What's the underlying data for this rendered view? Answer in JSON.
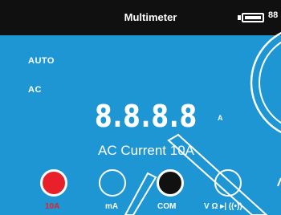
{
  "header": {
    "title": "Multimeter",
    "battery_level": "88"
  },
  "status": {
    "auto": "AUTO",
    "coupling": "AC"
  },
  "display": {
    "reading": "8.8.8.8",
    "unit": "A",
    "range_name": "AC Current 10A"
  },
  "jacks": [
    {
      "label": "10A",
      "color": "#e8202a",
      "state": "active"
    },
    {
      "label": "mA"
    },
    {
      "label": "COM",
      "color": "#111111"
    },
    {
      "label": "V Ω ▸|  ((•))"
    }
  ],
  "colors": {
    "background": "#1e96d4",
    "header": "#101010",
    "accent": "#e8202a"
  }
}
